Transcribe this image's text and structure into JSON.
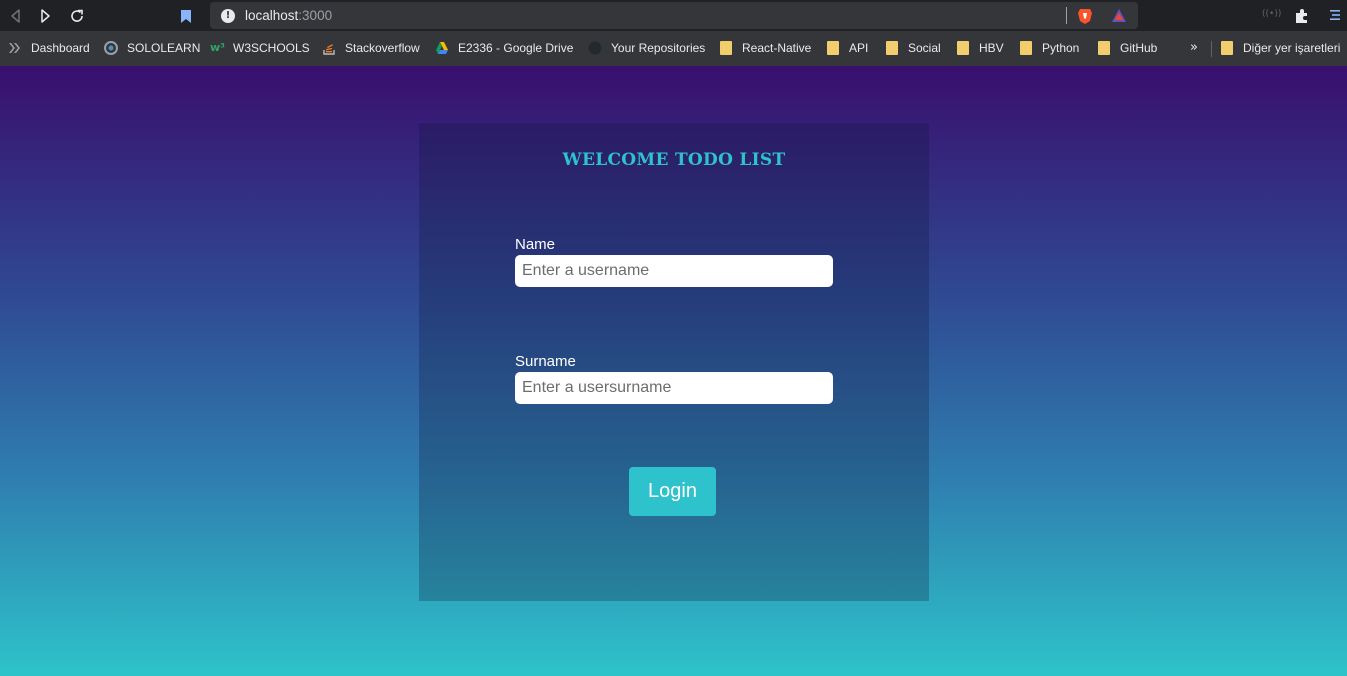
{
  "browser": {
    "url_host": "localhost",
    "url_port": ":3000",
    "bookmarks": [
      {
        "label": "Dashboard",
        "icon": "dashboard-icon"
      },
      {
        "label": "SOLOLEARN",
        "icon": "sololearn-icon"
      },
      {
        "label": "W3SCHOOLS",
        "icon": "w3schools-icon"
      },
      {
        "label": "Stackoverflow",
        "icon": "stackoverflow-icon"
      },
      {
        "label": "E2336 - Google Drive",
        "icon": "google-drive-icon"
      },
      {
        "label": "Your Repositories",
        "icon": "github-icon"
      },
      {
        "label": "React-Native",
        "icon": "folder-icon"
      },
      {
        "label": "API",
        "icon": "folder-icon"
      },
      {
        "label": "Social",
        "icon": "folder-icon"
      },
      {
        "label": "HBV",
        "icon": "folder-icon"
      },
      {
        "label": "Python",
        "icon": "folder-icon"
      },
      {
        "label": "GitHub",
        "icon": "folder-icon"
      }
    ],
    "more_label": "»",
    "other_bookmarks": "Diğer yer işaretleri"
  },
  "page": {
    "title": "WELCOME TODO LIST",
    "name_label": "Name",
    "name_placeholder": "Enter a username",
    "surname_label": "Surname",
    "surname_placeholder": "Enter a usersurname",
    "login_label": "Login"
  },
  "colors": {
    "accent": "#2ec3cc",
    "gradient_top": "#390f6e",
    "gradient_bottom": "#2ec3c9"
  }
}
